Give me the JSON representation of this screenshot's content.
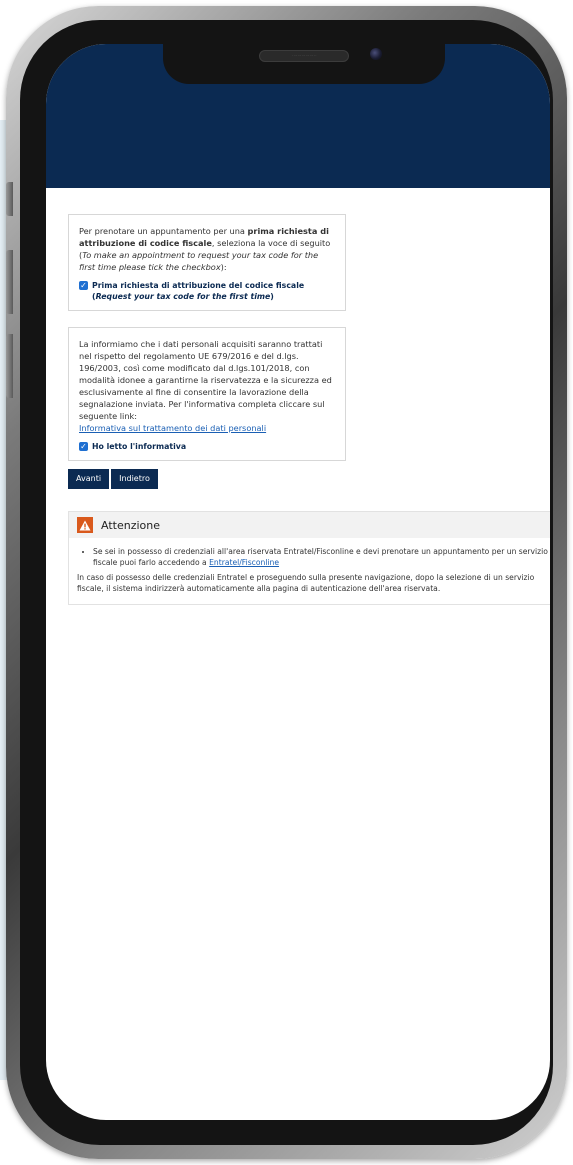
{
  "box1": {
    "intro_a": "Per prenotare un appuntamento per una ",
    "intro_bold": "prima richiesta di attribuzione di codice fiscale",
    "intro_b": ", seleziona la voce di seguito (",
    "intro_italic": "To make an appointment to request your tax code for the first time please tick the checkbox",
    "intro_c": "):",
    "checkbox_label": "Prima richiesta di attribuzione del codice fiscale (",
    "checkbox_label_italic": "Request your tax code for the first time",
    "checkbox_label_end": ")",
    "checked": true
  },
  "box2": {
    "text": "La informiamo che i dati personali acquisiti saranno trattati nel rispetto del regolamento UE 679/2016 e del d.lgs. 196/2003, così come modificato dal d.lgs.101/2018, con modalità idonee a garantirne la riservatezza e la sicurezza ed esclusivamente al fine di consentire la lavorazione della segnalazione inviata. Per l'informativa completa cliccare sul seguente link:",
    "link": "Informativa sul trattamento dei dati personali",
    "checkbox_label": "Ho letto l'informativa",
    "checked": true
  },
  "buttons": {
    "next": "Avanti",
    "back": "Indietro"
  },
  "alert": {
    "title": "Attenzione",
    "bullet_a": "Se sei in possesso di credenziali all'area riservata Entratel/Fisconline e devi prenotare un appuntamento per un servizio fiscale puoi farlo accedendo a ",
    "bullet_link": "Entratel/Fisconline",
    "paragraph": "In caso di possesso delle credenziali Entratel e proseguendo sulla presente navigazione, dopo la selezione di un servizio fiscale, il sistema indirizzerà automaticamente alla pagina di autenticazione dell'area riservata."
  },
  "colors": {
    "brand": "#0b2a52",
    "checkbox": "#1f6fd1",
    "warning": "#d9591c",
    "link": "#1a5fb4"
  }
}
